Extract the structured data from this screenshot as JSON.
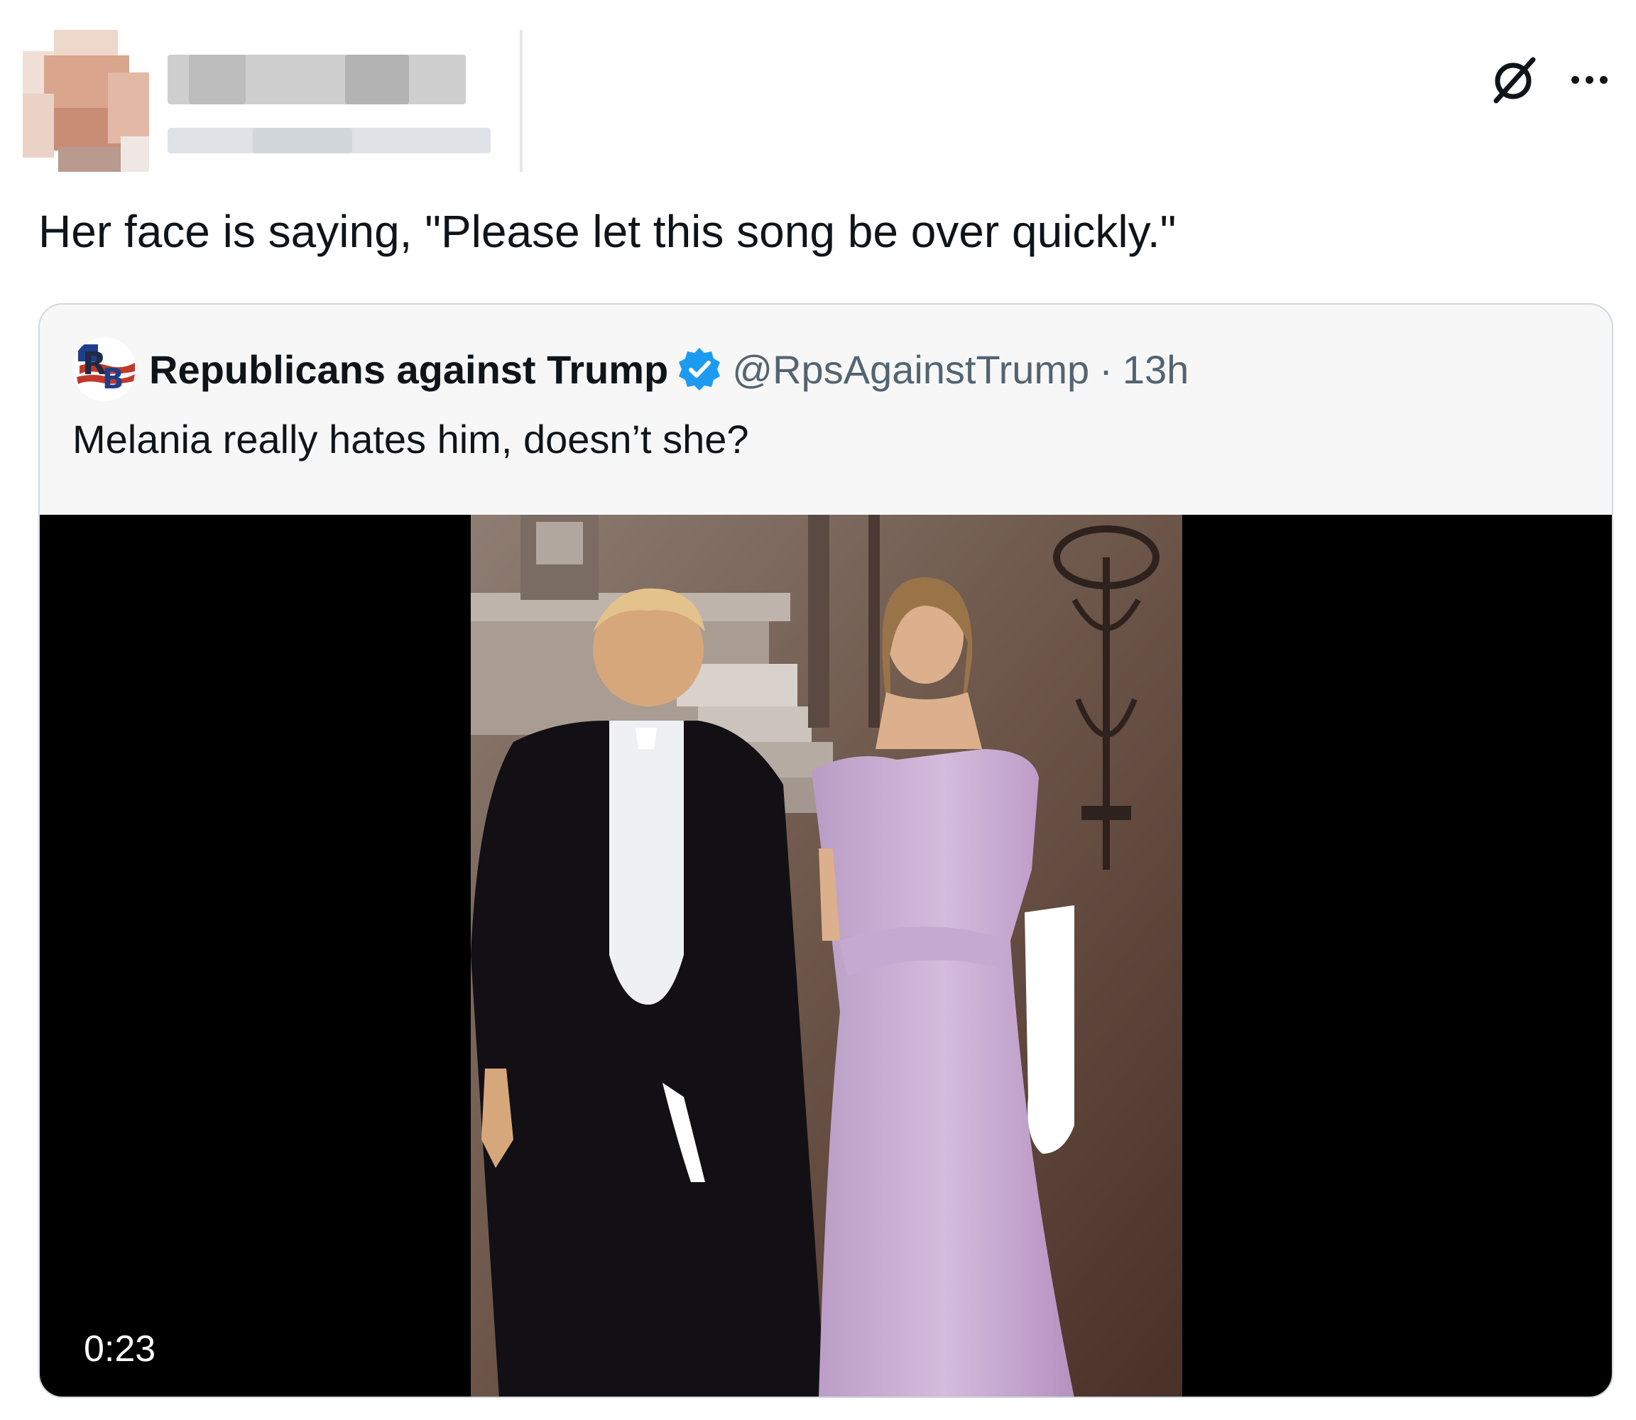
{
  "post": {
    "text": "Her face is saying, \"Please let this song be over quickly.\""
  },
  "quoted_post": {
    "author_name": "Republicans against Trump",
    "handle": "@RpsAgainstTrump",
    "separator": "·",
    "time": "13h",
    "text": "Melania really hates him, doesn’t she?",
    "verified": true,
    "video": {
      "duration": "0:23"
    }
  },
  "icons": {
    "grok": "grok-icon",
    "more": "more-icon",
    "verified": "verified-badge-icon"
  },
  "colors": {
    "verified_blue": "#1d9bf0",
    "muted_text": "#536471",
    "dress": "#c9aed3"
  }
}
